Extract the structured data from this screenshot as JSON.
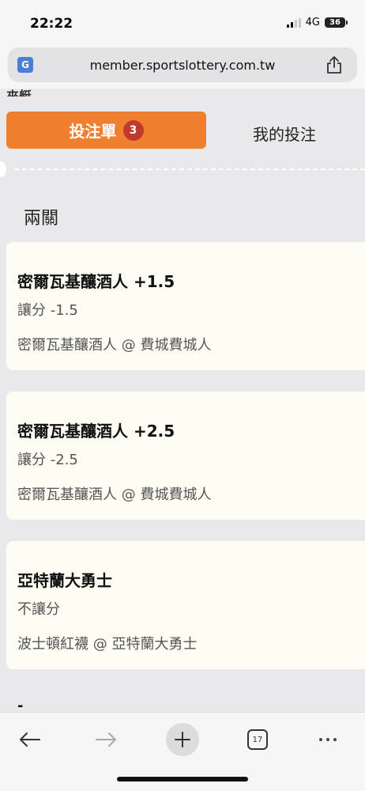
{
  "status_bar": {
    "time": "22:22",
    "network": "4G",
    "battery": "36"
  },
  "browser": {
    "url": "member.sportslottery.com.tw"
  },
  "page": {
    "cut_title": "來艇",
    "tabs": [
      {
        "label": "投注單",
        "badge": "3",
        "active": true
      },
      {
        "label": "我的投注",
        "active": false
      }
    ],
    "section_title": "兩關",
    "bets": [
      {
        "selection": "密爾瓦基釀酒人 +1.5",
        "market": "讓分 -1.5",
        "match": "密爾瓦基釀酒人 @ 費城費城人"
      },
      {
        "selection": "密爾瓦基釀酒人 +2.5",
        "market": "讓分 -2.5",
        "match": "密爾瓦基釀酒人 @ 費城費城人"
      },
      {
        "selection": "亞特蘭大勇士",
        "market": "不讓分",
        "match": "波士頓紅襪 @ 亞特蘭大勇士"
      }
    ],
    "footer_partial": "-"
  },
  "toolbar": {
    "tab_count": "17"
  },
  "colors": {
    "accent": "#f08030",
    "badge": "#c0392b",
    "card_bg": "#fefcf3"
  }
}
